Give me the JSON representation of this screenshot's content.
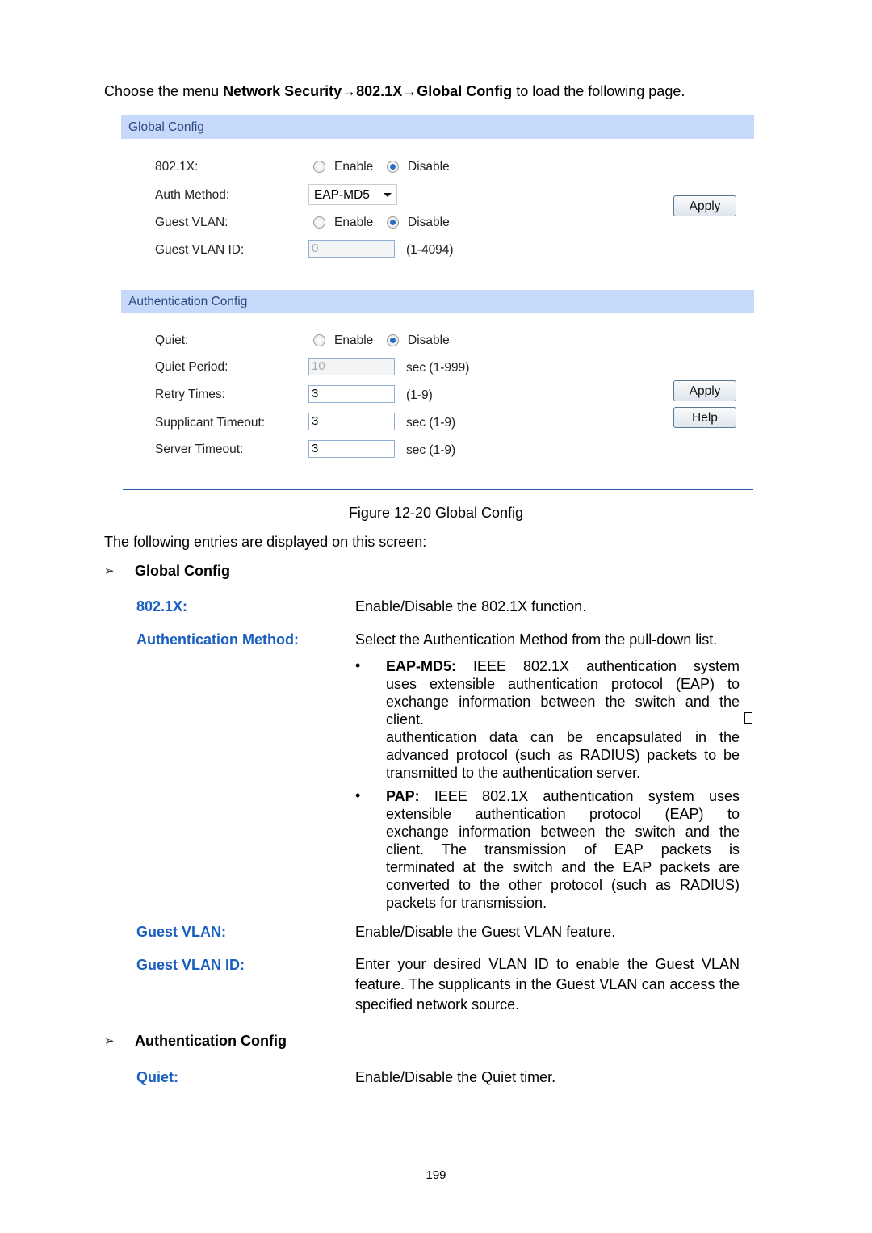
{
  "intro": {
    "prefix": "Choose the menu ",
    "menu_path": "Network Security→802.1X→Global Config",
    "suffix": " to load the following page."
  },
  "global_config": {
    "title": "Global Config",
    "rows": {
      "dot1x": {
        "label": "802.1X:",
        "enable": "Enable",
        "disable": "Disable",
        "selected": "Disable"
      },
      "auth_method": {
        "label": "Auth Method:",
        "value": "EAP-MD5"
      },
      "guest_vlan": {
        "label": "Guest VLAN:",
        "enable": "Enable",
        "disable": "Disable",
        "selected": "Disable"
      },
      "guest_vlan_id": {
        "label": "Guest VLAN ID:",
        "value": "0",
        "hint": "(1-4094)"
      }
    },
    "apply": "Apply"
  },
  "auth_config": {
    "title": "Authentication Config",
    "rows": {
      "quiet": {
        "label": "Quiet:",
        "enable": "Enable",
        "disable": "Disable",
        "selected": "Disable"
      },
      "quiet_period": {
        "label": "Quiet Period:",
        "value": "10",
        "hint": "sec (1-999)"
      },
      "retry_times": {
        "label": "Retry Times:",
        "value": "3",
        "hint": "(1-9)"
      },
      "supplicant_timeout": {
        "label": "Supplicant Timeout:",
        "value": "3",
        "hint": "sec (1-9)"
      },
      "server_timeout": {
        "label": "Server Timeout:",
        "value": "3",
        "hint": "sec (1-9)"
      }
    },
    "apply": "Apply",
    "help": "Help"
  },
  "figure_caption": "Figure 12-20 Global Config",
  "entries_intro": "The following entries are displayed on this screen:",
  "sections": {
    "global": {
      "heading": "Global Config",
      "dot1x": {
        "term": "802.1X:",
        "desc": "Enable/Disable the 802.1X function."
      },
      "auth_method": {
        "term": "Authentication Method:",
        "desc": "Select the Authentication Method from the pull-down list.",
        "eap": {
          "name": "EAP-MD5:",
          "lines": [
            "IEEE 802.1X authentication system",
            "uses extensible authentication protocol (EAP) to",
            "exchange information between the switch and the",
            "client.",
            "authentication data can be encapsulated in the",
            "advanced protocol (such as RADIUS) packets to be",
            "transmitted to the authentication server."
          ]
        },
        "pap": {
          "name": "PAP:",
          "lines": [
            "IEEE 802.1X authentication system uses",
            "extensible authentication protocol (EAP) to",
            "exchange information between the switch and the",
            "client. The transmission of EAP packets is",
            "terminated at the switch and the EAP packets are",
            "converted to the other protocol (such as RADIUS)",
            "packets for transmission."
          ]
        }
      },
      "guest_vlan": {
        "term": "Guest VLAN:",
        "desc": "Enable/Disable the Guest VLAN feature."
      },
      "guest_vlan_id": {
        "term": "Guest VLAN ID:",
        "desc": "Enter your desired VLAN ID to enable the Guest VLAN feature. The supplicants in the Guest VLAN can access the specified network source."
      }
    },
    "auth": {
      "heading": "Authentication Config",
      "quiet": {
        "term": "Quiet:",
        "desc": "Enable/Disable the Quiet timer."
      }
    }
  },
  "page_number": "199",
  "colors": {
    "term": "#1a5fc0",
    "header_bar": "#c6d9fb",
    "rule": "#2a5aa8"
  }
}
